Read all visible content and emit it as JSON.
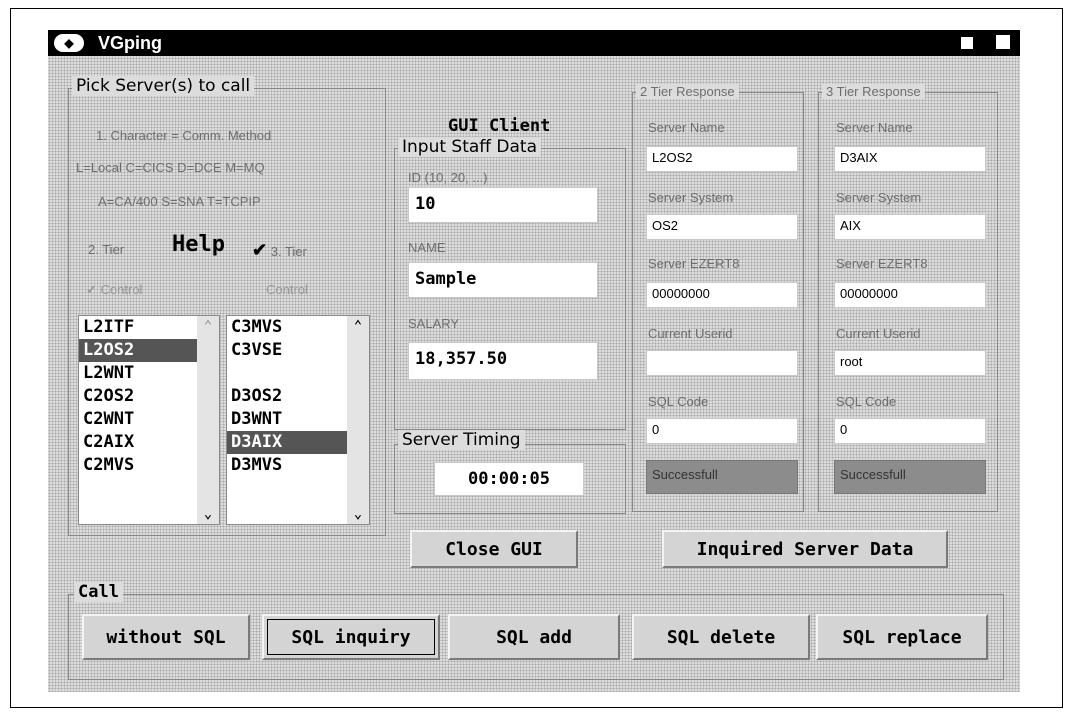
{
  "window": {
    "title": "VGping"
  },
  "pick": {
    "title": "Pick Server(s) to call",
    "line1": "1. Character = Comm. Method",
    "line2": "L=Local C=CICS D=DCE M=MQ",
    "line3": "A=CA/400 S=SNA T=TCPIP",
    "tier2": "2. Tier",
    "help": "Help",
    "tier3": "3. Tier",
    "control_left": "Control",
    "control_right": "Control",
    "list2": [
      {
        "label": "L2ITF",
        "selected": false
      },
      {
        "label": "L2OS2",
        "selected": true
      },
      {
        "label": "L2WNT",
        "selected": false
      },
      {
        "label": "C2OS2",
        "selected": false
      },
      {
        "label": "C2WNT",
        "selected": false
      },
      {
        "label": "C2AIX",
        "selected": false
      },
      {
        "label": "C2MVS",
        "selected": false
      }
    ],
    "list3": [
      {
        "label": "C3MVS",
        "selected": false
      },
      {
        "label": "C3VSE",
        "selected": false
      },
      {
        "label": "",
        "selected": false
      },
      {
        "label": "D3OS2",
        "selected": false
      },
      {
        "label": "D3WNT",
        "selected": false
      },
      {
        "label": "D3AIX",
        "selected": true
      },
      {
        "label": "D3MVS",
        "selected": false
      }
    ]
  },
  "gui": {
    "title": "GUI Client",
    "input_title": "Input Staff Data",
    "id_label": "ID (10, 20, ...)",
    "id_value": "10",
    "name_label": "NAME",
    "name_value": "Sample",
    "salary_label": "SALARY",
    "salary_value": "18,357.50",
    "timing_title": "Server Timing",
    "timing_value": "00:00:05"
  },
  "tier2": {
    "title": "2 Tier Response",
    "server_name_label": "Server Name",
    "server_name": "L2OS2",
    "server_system_label": "Server System",
    "server_system": "OS2",
    "ezerto_label": "Server EZERT8",
    "ezerto": "00000000",
    "userid_label": "Current Userid",
    "userid": "",
    "sql_label": "SQL Code",
    "sql_code": "0",
    "status": "Successfull"
  },
  "tier3": {
    "title": "3 Tier Response",
    "server_name_label": "Server Name",
    "server_name": "D3AIX",
    "server_system_label": "Server System",
    "server_system": "AIX",
    "ezerto_label": "Server EZERT8",
    "ezerto": "00000000",
    "userid_label": "Current Userid",
    "userid": "root",
    "sql_label": "SQL Code",
    "sql_code": "0",
    "status": "Successfull"
  },
  "buttons": {
    "close_gui": "Close GUI",
    "inquired": "Inquired Server Data"
  },
  "call": {
    "title": "Call",
    "without_sql": "without SQL",
    "sql_inquiry": "SQL inquiry",
    "sql_add": "SQL add",
    "sql_delete": "SQL delete",
    "sql_replace": "SQL replace"
  }
}
